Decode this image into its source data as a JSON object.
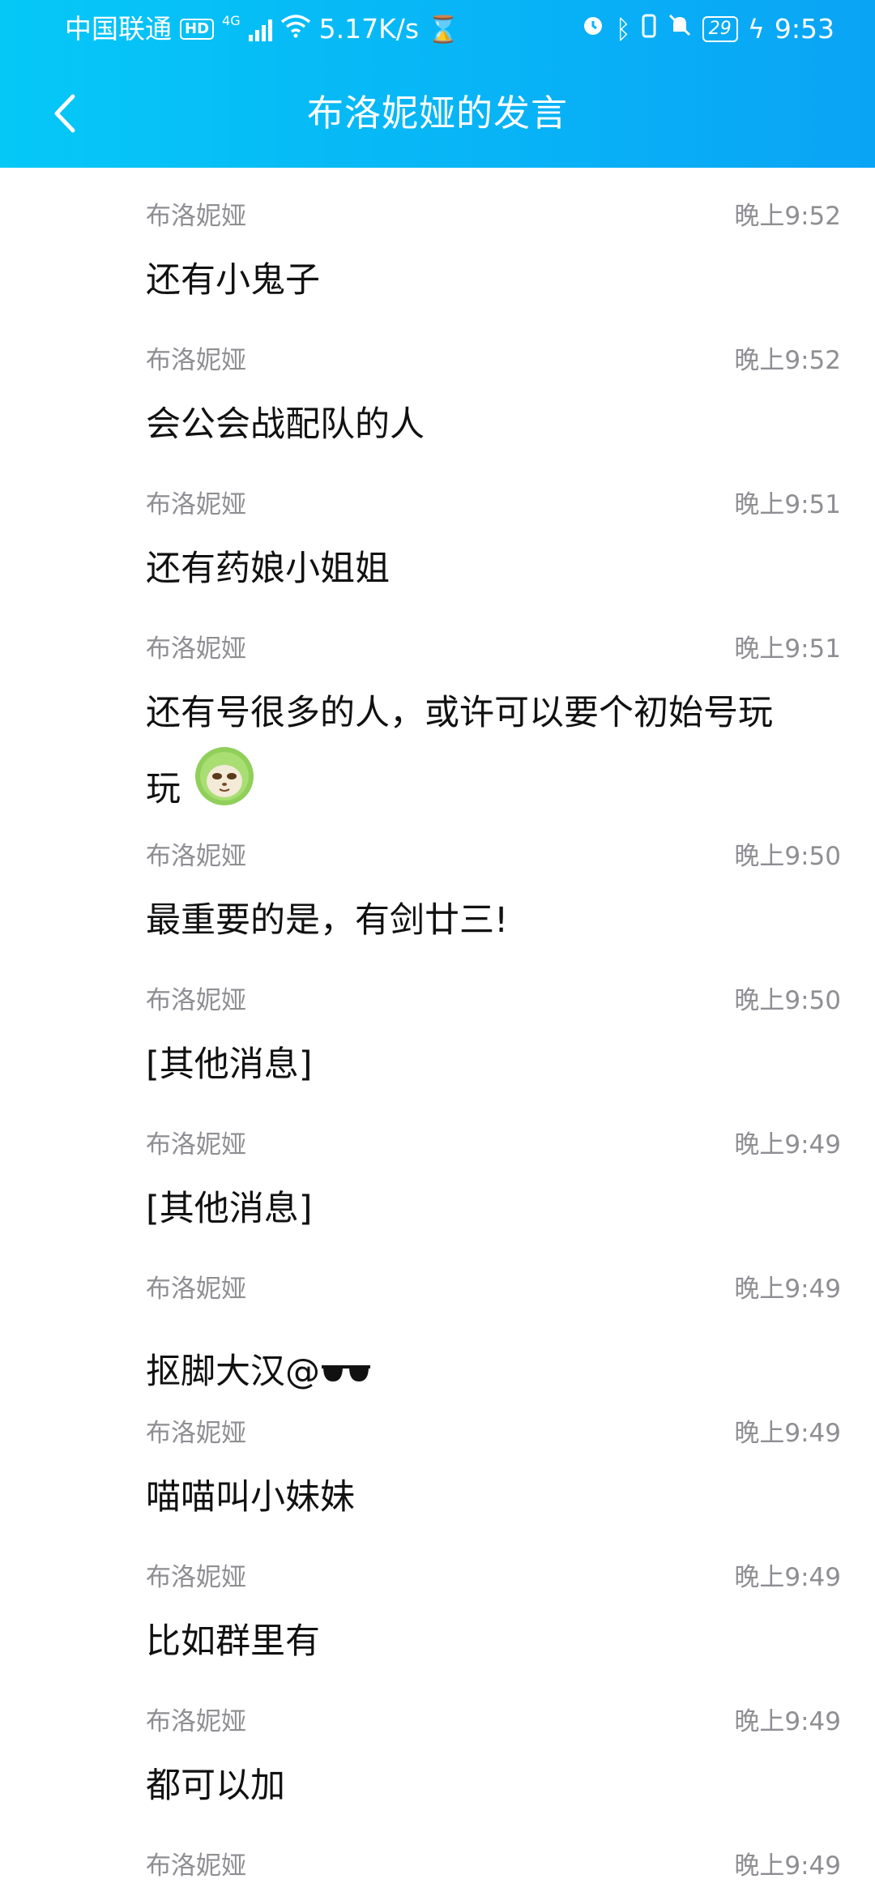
{
  "status_bar": {
    "carrier": "中国联通",
    "hd": "HD",
    "network": "4G",
    "speed": "5.17K/s",
    "battery": "29",
    "time": "9:53"
  },
  "header": {
    "title": "布洛妮娅的发言"
  },
  "messages": [
    {
      "sender": "布洛妮娅",
      "time": "晚上9:52",
      "text": "还有小鬼子"
    },
    {
      "sender": "布洛妮娅",
      "time": "晚上9:52",
      "text": "会公会战配队的人"
    },
    {
      "sender": "布洛妮娅",
      "time": "晚上9:51",
      "text": "还有药娘小姐姐"
    },
    {
      "sender": "布洛妮娅",
      "time": "晚上9:51",
      "text_line1": "还有号很多的人，或许可以要个初始号玩",
      "text_line2": "玩"
    },
    {
      "sender": "布洛妮娅",
      "time": "晚上9:50",
      "text": "最重要的是，有剑廿三!"
    },
    {
      "sender": "布洛妮娅",
      "time": "晚上9:50",
      "text": "[其他消息]"
    },
    {
      "sender": "布洛妮娅",
      "time": "晚上9:49",
      "text": "[其他消息]"
    },
    {
      "sender": "布洛妮娅",
      "time": "晚上9:49",
      "text": "抠脚大汉@"
    },
    {
      "sender": "布洛妮娅",
      "time": "晚上9:49",
      "text": "喵喵叫小妹妹"
    },
    {
      "sender": "布洛妮娅",
      "time": "晚上9:49",
      "text": "比如群里有"
    },
    {
      "sender": "布洛妮娅",
      "time": "晚上9:49",
      "text": "都可以加"
    },
    {
      "sender": "布洛妮娅",
      "time": "晚上9:49",
      "text": ""
    }
  ]
}
